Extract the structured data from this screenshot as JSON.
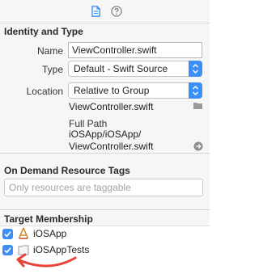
{
  "tabs": [
    {
      "name": "file-inspector-tab",
      "icon": "document-icon"
    },
    {
      "name": "quick-help-tab",
      "icon": "question-circle-icon"
    }
  ],
  "identity": {
    "title": "Identity and Type",
    "name_label": "Name",
    "name_value": "ViewController.swift",
    "type_label": "Type",
    "type_value": "Default - Swift Source",
    "location_label": "Location",
    "location_value": "Relative to Group",
    "location_file": "ViewController.swift",
    "fullpath_label": "Full Path",
    "fullpath_line1": "iOSApp/iOSApp/",
    "fullpath_line2": "ViewController.swift"
  },
  "ondemand": {
    "title": "On Demand Resource Tags",
    "placeholder": "Only resources are taggable"
  },
  "target": {
    "title": "Target Membership",
    "items": [
      {
        "label": "iOSApp",
        "checked": true,
        "icon": "app-target-icon"
      },
      {
        "label": "iOSAppTests",
        "checked": true,
        "icon": "test-bundle-icon"
      }
    ]
  },
  "colors": {
    "accent": "#3b8ff6",
    "annotation": "#e8433a"
  }
}
